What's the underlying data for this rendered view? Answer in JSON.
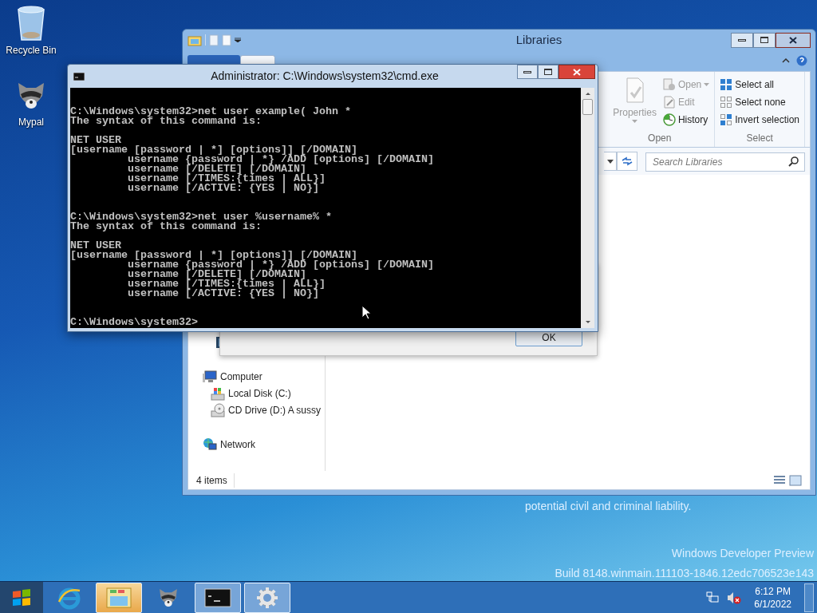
{
  "desktop": {
    "icons": [
      {
        "kind": "recycle-bin",
        "label": "Recycle Bin"
      },
      {
        "kind": "raccoon",
        "label": "Mypal"
      }
    ],
    "notices": [
      "potential civil and criminal liability.",
      "Windows Developer Preview",
      "Build 8148.winmain.111103-1846.12edc706523e143"
    ]
  },
  "explorer": {
    "title": "Libraries",
    "ribbon_groups": [
      {
        "label": "Open",
        "items": [
          {
            "label": "Properties",
            "kind": "large",
            "disabled": true,
            "dropdown": true
          },
          {
            "label": "Open",
            "kind": "small",
            "disabled": true,
            "dropdown": true
          },
          {
            "label": "Edit",
            "kind": "small",
            "disabled": true,
            "dropdown": false
          },
          {
            "label": "History",
            "kind": "small",
            "disabled": false,
            "dropdown": false
          }
        ]
      },
      {
        "label": "Select",
        "items": [
          {
            "label": "Select all",
            "kind": "small",
            "disabled": false,
            "dropdown": false
          },
          {
            "label": "Select none",
            "kind": "small",
            "disabled": false,
            "dropdown": false
          },
          {
            "label": "Invert selection",
            "kind": "small",
            "disabled": false,
            "dropdown": false
          }
        ]
      }
    ],
    "search": {
      "placeholder": "Search Libraries"
    },
    "nav": [
      {
        "label": "Computer",
        "children": [
          {
            "label": "Local Disk (C:)"
          },
          {
            "label": "CD Drive (D:) A sussy"
          }
        ]
      },
      {
        "label": "Network"
      }
    ],
    "status": "4 items"
  },
  "dialog": {
    "button": "OK"
  },
  "console": {
    "title": "Administrator: C:\\Windows\\system32\\cmd.exe",
    "blocks": [
      {
        "kind": "command",
        "lines": [
          "C:\\Windows\\system32>net user example( John *",
          "The syntax of this command is:"
        ]
      },
      {
        "kind": "output",
        "lines": [
          "NET USER",
          "[username [password | *] [options]] [/DOMAIN]",
          "         username {password | *} /ADD [options] [/DOMAIN]",
          "         username [/DELETE] [/DOMAIN]",
          "         username [/TIMES:{times | ALL}]",
          "         username [/ACTIVE: {YES | NO}]"
        ]
      },
      {
        "kind": "command",
        "lines": [
          "C:\\Windows\\system32>net user %username% *",
          "The syntax of this command is:"
        ]
      },
      {
        "kind": "output",
        "lines": [
          "NET USER",
          "[username [password | *] [options]] [/DOMAIN]",
          "         username {password | *} /ADD [options] [/DOMAIN]",
          "         username [/DELETE] [/DOMAIN]",
          "         username [/TIMES:{times | ALL}]",
          "         username [/ACTIVE: {YES | NO}]"
        ]
      },
      {
        "kind": "command",
        "lines": [
          "C:\\Windows\\system32>"
        ]
      }
    ]
  },
  "taskbar": {
    "apps": [
      {
        "running": false,
        "attention": false
      },
      {
        "running": true,
        "attention": true
      },
      {
        "running": false,
        "attention": false
      },
      {
        "running": true,
        "attention": false
      },
      {
        "running": true,
        "attention": false
      }
    ],
    "time": "6:12 PM",
    "date": "6/1/2022"
  }
}
